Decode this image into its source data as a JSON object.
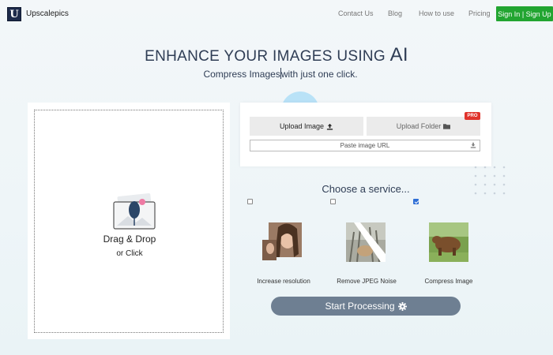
{
  "header": {
    "logo_letter": "U",
    "brand": "Upscalepics",
    "nav": [
      "Contact Us",
      "Blog",
      "How to use",
      "Pricing"
    ],
    "signin_label": "Sign In | Sign Up"
  },
  "hero": {
    "title_main": "ENHANCE YOUR IMAGES USING ",
    "title_ai": "AI",
    "subtitle_left": "Compress Images",
    "subtitle_right": "with just one click."
  },
  "drop": {
    "title": "Drag & Drop",
    "subtitle": "or Click"
  },
  "upload": {
    "image_label": "Upload Image",
    "folder_label": "Upload Folder",
    "pro_badge": "PRO",
    "url_label": "Paste image URL"
  },
  "services": {
    "title": "Choose a service...",
    "items": [
      {
        "label": "Increase resolution",
        "checked": false
      },
      {
        "label": "Remove JPEG Noise",
        "checked": false
      },
      {
        "label": "Compress Image",
        "checked": true
      }
    ]
  },
  "start_label": "Start Processing",
  "colors": {
    "accent_green": "#22a531",
    "start_button": "#6e7f92",
    "pro_red": "#e0332c",
    "title_navy": "#2f3d55"
  }
}
